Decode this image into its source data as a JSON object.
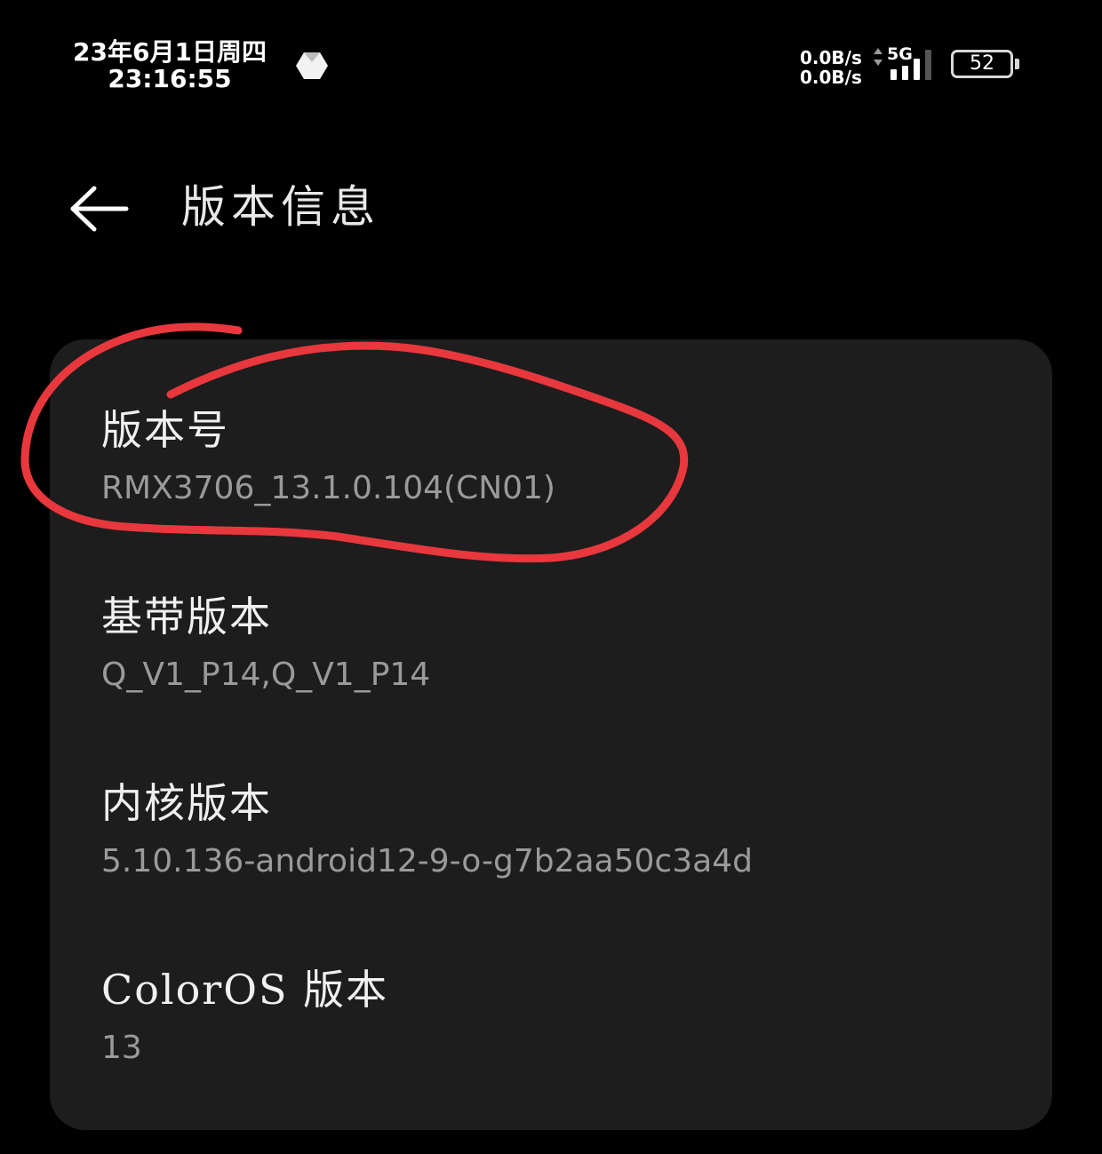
{
  "status_bar": {
    "date": "23年6月1日周四",
    "time": "23:16:55",
    "net_up": "0.0B/s",
    "net_down": "0.0B/s",
    "network_type": "5G",
    "battery_level": "52",
    "notification_icon": "hexagon-app-icon",
    "signal_icon": "cellular-signal-icon",
    "battery_icon": "battery-icon"
  },
  "header": {
    "back_icon": "arrow-left-icon",
    "title": "版本信息"
  },
  "items": [
    {
      "label": "版本号",
      "value": "RMX3706_13.1.0.104(CN01)"
    },
    {
      "label": "基带版本",
      "value": "Q_V1_P14,Q_V1_P14"
    },
    {
      "label": "内核版本",
      "value": "5.10.136-android12-9-o-g7b2aa50c3a4d"
    },
    {
      "label": "ColorOS 版本",
      "value": "13"
    }
  ],
  "colors": {
    "background": "#000000",
    "card": "#1d1d1d",
    "label": "#f0f0f0",
    "value": "#9a9a9a",
    "annotation": "#e8383d"
  }
}
